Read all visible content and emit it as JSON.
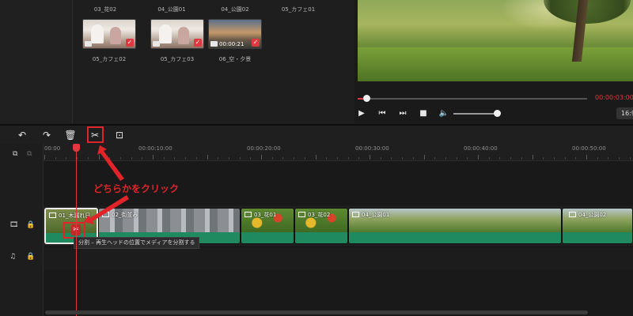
{
  "media": {
    "row1_labels": [
      "03_花02",
      "04_公園01",
      "04_公園02",
      "05_カフェ01"
    ],
    "items": [
      {
        "label": "05_カフェ02",
        "kind": "image",
        "selected": true
      },
      {
        "label": "05_カフェ03",
        "kind": "image",
        "selected": true
      },
      {
        "label": "06_空・夕景",
        "kind": "video",
        "duration": "00:00:21",
        "selected": true
      }
    ]
  },
  "preview": {
    "timecode": "00:00:03:00",
    "aspect_label": "16:9",
    "progress_fraction": 0.04,
    "volume_fraction": 0.9,
    "icons": {
      "play": "play-icon",
      "prev": "step-back-icon",
      "next": "step-forward-icon",
      "stop": "stop-icon",
      "volume": "volume-icon"
    }
  },
  "toolbar": {
    "icons": [
      "undo-icon",
      "redo-icon",
      "delete-icon",
      "split-scissors-icon",
      "crop-icon"
    ]
  },
  "timeline": {
    "ruler_labels": [
      "00:00",
      "00:00:10:00",
      "00:00:20:00",
      "00:00:30:00",
      "00:00:40:00",
      "00:00:50:00"
    ],
    "clips": [
      {
        "label": "01_木漏れ日",
        "kind": "image"
      },
      {
        "label": "02_街並み",
        "kind": "image"
      },
      {
        "label": "03_花01",
        "kind": "image"
      },
      {
        "label": "03_花02",
        "kind": "image"
      },
      {
        "label": "04_公園01",
        "kind": "video"
      },
      {
        "label": "04_公園02",
        "kind": "video"
      }
    ],
    "tooltip": "分割 – 再生ヘッドの位置でメディアを分割する"
  },
  "annotation": {
    "text": "どちらかをクリック",
    "color": "#e0242a"
  },
  "colors": {
    "accent": "#e0383e",
    "audio_wave": "#1f8a60",
    "background": "#1b1b1b"
  }
}
